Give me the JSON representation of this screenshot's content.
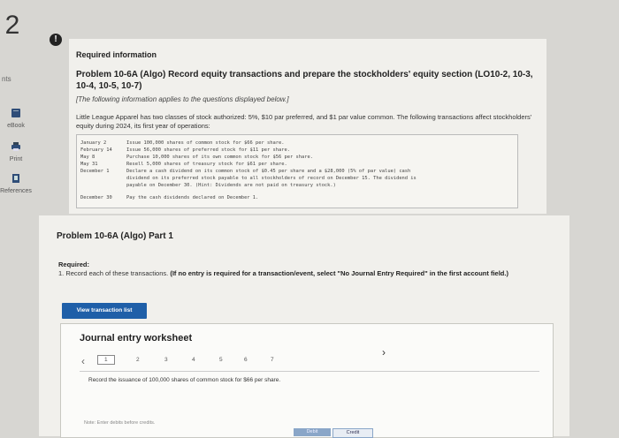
{
  "question_number": "2",
  "alert_badge": "!",
  "points_label": "nts",
  "sidebar": {
    "items": [
      {
        "label": "eBook",
        "icon": "book-icon"
      },
      {
        "label": "Print",
        "icon": "print-icon"
      },
      {
        "label": "References",
        "icon": "references-icon"
      }
    ]
  },
  "header": {
    "required_info": "Required information",
    "problem_title": "Problem 10-6A (Algo) Record equity transactions and prepare the stockholders' equity section (LO10-2, 10-3, 10-4, 10-5, 10-7)",
    "italic_note": "[The following information applies to the questions displayed below.]",
    "intro": "Little League Apparel has two classes of stock authorized: 5%, $10 par preferred, and $1 par value common. The following transactions affect stockholders' equity during 2024, its first year of operations:"
  },
  "transactions": [
    {
      "date": "January 2",
      "text": "Issue 100,000 shares of common stock for $66 per share."
    },
    {
      "date": "February 14",
      "text": "Issue 56,000 shares of preferred stock for $11 per share."
    },
    {
      "date": "May 8",
      "text": "Purchase 10,000 shares of its own common stock for $56 per share."
    },
    {
      "date": "May 31",
      "text": "Resell 5,000 shares of treasury stock for $61 per share."
    },
    {
      "date": "December 1",
      "text": "Declare a cash dividend on its common stock of $0.45 per share and a $28,000 (5% of par value) cash"
    },
    {
      "date": "",
      "text": "dividend on its preferred stock payable to all stockholders of record on December 15. The dividend is"
    },
    {
      "date": "",
      "text": "payable on December 30. (Hint: Dividends are not paid on treasury stock.)"
    },
    {
      "date": "December 30",
      "text": "Pay the cash dividends declared on December 1."
    }
  ],
  "part": {
    "title": "Problem 10-6A (Algo) Part 1",
    "required": "Required:",
    "record_text": "1. Record each of these transactions.",
    "record_bold": "(If no entry is required for a transaction/event, select \"No Journal Entry Required\" in the first account field.)",
    "view_button": "View transaction list"
  },
  "worksheet": {
    "title": "Journal entry worksheet",
    "tabs": [
      "1",
      "2",
      "3",
      "4",
      "5",
      "6",
      "7"
    ],
    "active_tab": "1",
    "instruction": "Record the issuance of 100,000 shares of common stock for $66 per share.",
    "note": "Note: Enter debits before credits.",
    "debit_label": "Debit",
    "credit_label": "Credit"
  }
}
